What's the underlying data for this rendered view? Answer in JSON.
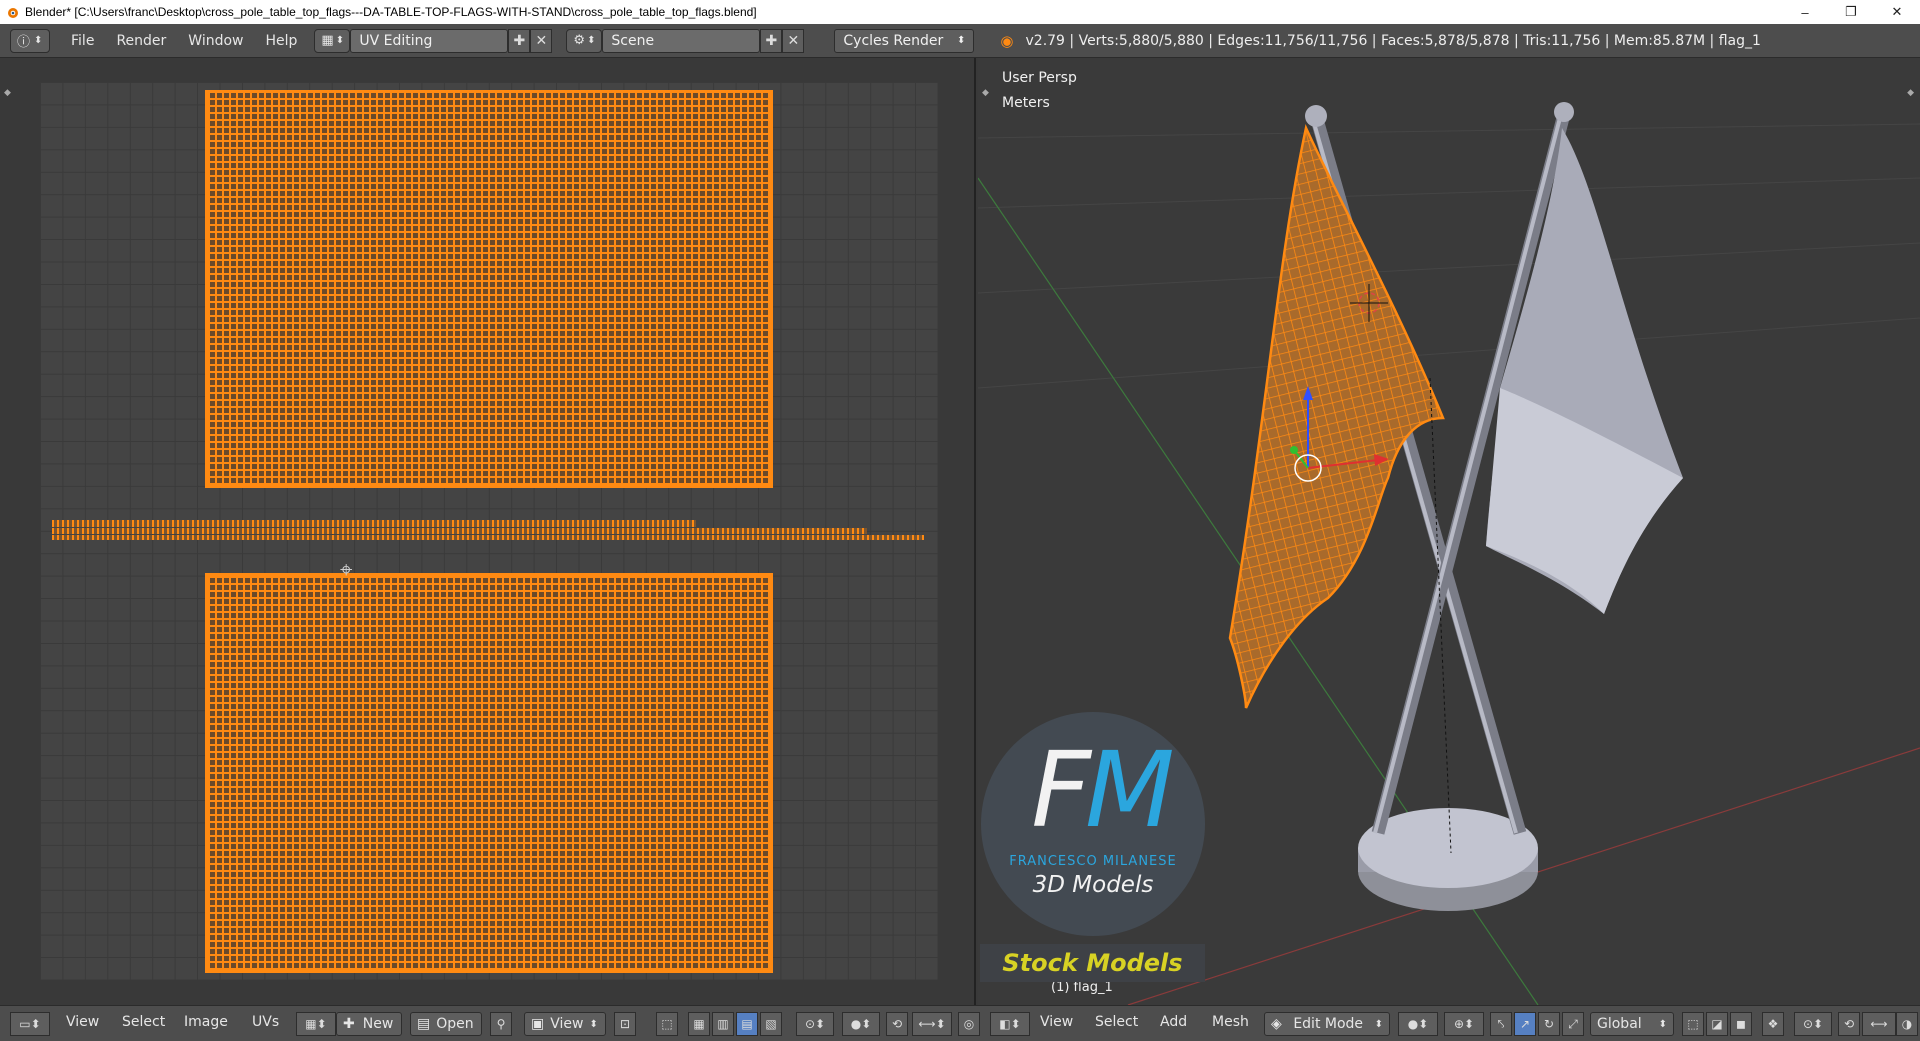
{
  "window": {
    "title": "Blender* [C:\\Users\\franc\\Desktop\\cross_pole_table_top_flags---DA-TABLE-TOP-FLAGS-WITH-STAND\\cross_pole_table_top_flags.blend]",
    "minimize": "–",
    "maximize": "❐",
    "close": "✕"
  },
  "infobar": {
    "menus": [
      "File",
      "Render",
      "Window",
      "Help"
    ],
    "layout": "UV Editing",
    "scene": "Scene",
    "engine": "Cycles Render",
    "stats": "v2.79 | Verts:5,880/5,880 | Edges:11,756/11,756 | Faces:5,878/5,878 | Tris:11,756 | Mem:85.87M | flag_1"
  },
  "viewport": {
    "view_name": "User Persp",
    "units": "Meters",
    "object_label": "(1) flag_1"
  },
  "logo": {
    "fm_f": "F",
    "fm_m": "M",
    "name": "FRANCESCO MILANESE",
    "subtitle": "3D Models",
    "stock": "Stock Models"
  },
  "uv_bar": {
    "view": "View",
    "select": "Select",
    "image": "Image",
    "uvs": "UVs",
    "new": "New",
    "open": "Open",
    "view2": "View"
  },
  "v3d_bar": {
    "view": "View",
    "select": "Select",
    "add": "Add",
    "mesh": "Mesh",
    "mode": "Edit Mode",
    "orientation": "Global"
  },
  "colors": {
    "accent": "#ff8a12",
    "panel": "#4d4d4d",
    "viewport_bg": "#3a3a3a",
    "logo_blue": "#2ba6de",
    "stock_yellow": "#d8d224"
  }
}
